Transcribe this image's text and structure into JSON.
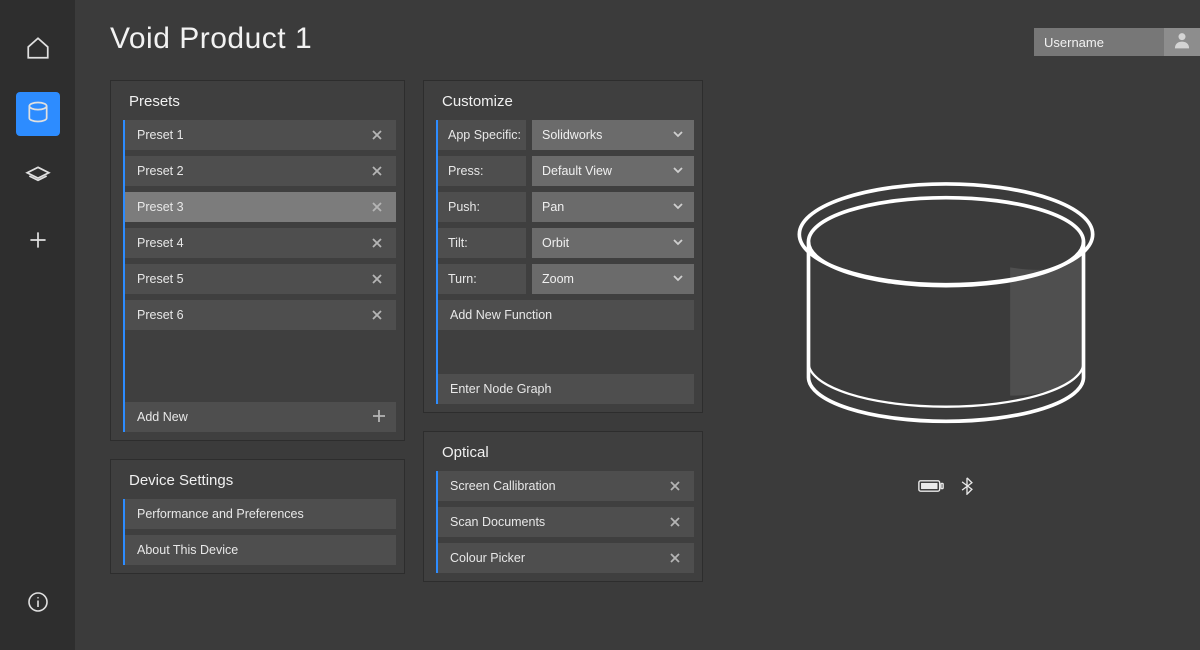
{
  "page_title": "Void Product 1",
  "username_label": "Username",
  "presets": {
    "title": "Presets",
    "items": [
      "Preset 1",
      "Preset 2",
      "Preset 3",
      "Preset 4",
      "Preset 5",
      "Preset 6"
    ],
    "selected_index": 2,
    "add_new_label": "Add New"
  },
  "device_settings": {
    "title": "Device Settings",
    "items": [
      "Performance and Preferences",
      "About This Device"
    ]
  },
  "customize": {
    "title": "Customize",
    "rows": [
      {
        "label": "App Specific:",
        "value": "Solidworks"
      },
      {
        "label": "Press:",
        "value": "Default View"
      },
      {
        "label": "Push:",
        "value": "Pan"
      },
      {
        "label": "Tilt:",
        "value": "Orbit"
      },
      {
        "label": "Turn:",
        "value": "Zoom"
      }
    ],
    "add_new_function_label": "Add New Function",
    "enter_node_graph_label": "Enter Node Graph"
  },
  "optical": {
    "title": "Optical",
    "items": [
      "Screen Callibration",
      "Scan Documents",
      "Colour Picker"
    ]
  }
}
